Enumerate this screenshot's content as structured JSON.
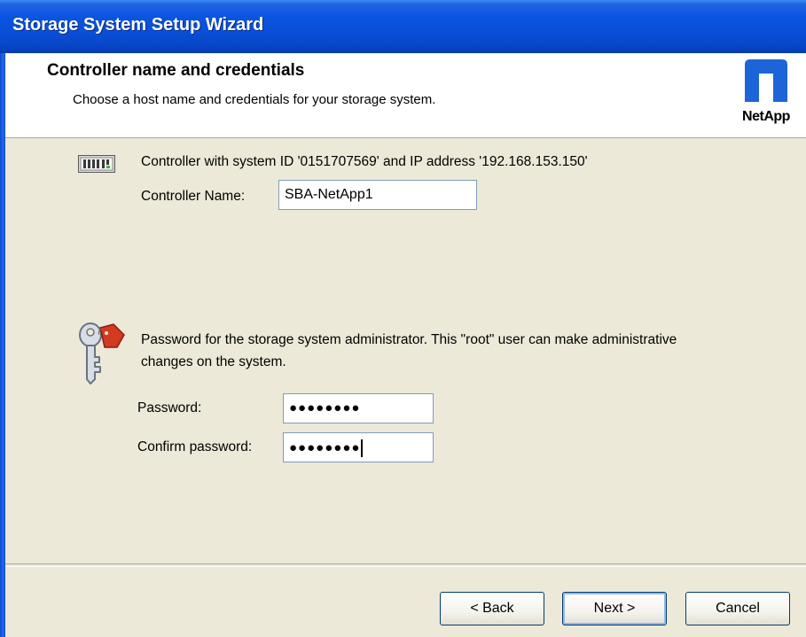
{
  "window": {
    "title": "Storage System Setup Wizard"
  },
  "header": {
    "title": "Controller name and credentials",
    "subtitle": "Choose a host name and credentials for your storage system.",
    "logo_text": "NetApp",
    "logo_icon": "netapp-logo-icon",
    "brand_color": "#1D64D8"
  },
  "controller": {
    "icon": "server-icon",
    "description": "Controller with system ID '0151707569' and IP address '192.168.153.150'",
    "name_label": "Controller Name:",
    "name_value": "SBA-NetApp1"
  },
  "credentials": {
    "icon": "key-icon",
    "description_line1": "Password for the storage system administrator.  This \"root\" user can make administrative",
    "description_line2": "changes on the system.",
    "password_label": "Password:",
    "password_value": "●●●●●●●●",
    "confirm_label": "Confirm password:",
    "confirm_value": "●●●●●●●●"
  },
  "buttons": {
    "back": "< Back",
    "next": "Next >",
    "cancel": "Cancel"
  }
}
